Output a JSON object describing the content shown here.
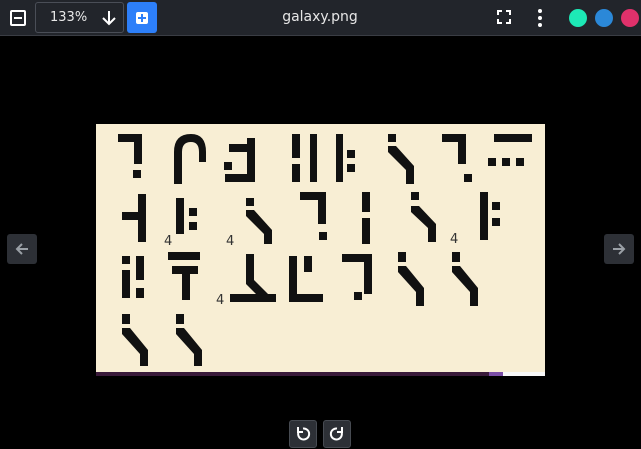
{
  "toolbar": {
    "zoom_value": "133%",
    "file_name": "galaxy.png",
    "icons": [
      "zoom-out-icon",
      "arrow-down-icon",
      "zoom-in-icon",
      "fullscreen-icon",
      "more-vert-icon"
    ],
    "color_dots": [
      "#1de9b6",
      "#2b88d8",
      "#e0316b"
    ]
  },
  "image": {
    "labels": [
      "4",
      "4",
      "4",
      "4"
    ],
    "background": "#f8eed4"
  },
  "navigation": {
    "prev_icon": "arrow-left-icon",
    "next_icon": "arrow-right-icon"
  },
  "rotate": {
    "left_icon": "rotate-left-icon",
    "right_icon": "rotate-right-icon"
  }
}
